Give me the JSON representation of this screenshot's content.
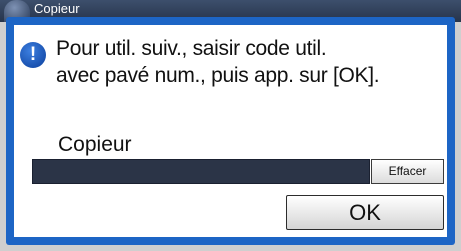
{
  "header": {
    "mode_label": "Copieur",
    "mode_icon": "copier-mode-icon"
  },
  "dialog": {
    "icon": "info-icon",
    "icon_glyph": "!",
    "message_lines": [
      "Pour util. suiv., saisir code util.",
      "avec pavé num., puis app. sur [OK]."
    ],
    "field_label": "Copieur",
    "input_value": "",
    "clear_label": "Effacer",
    "ok_label": "OK"
  },
  "colors": {
    "dialog_frame": "#1d65c5",
    "input_background": "#2b3447"
  }
}
